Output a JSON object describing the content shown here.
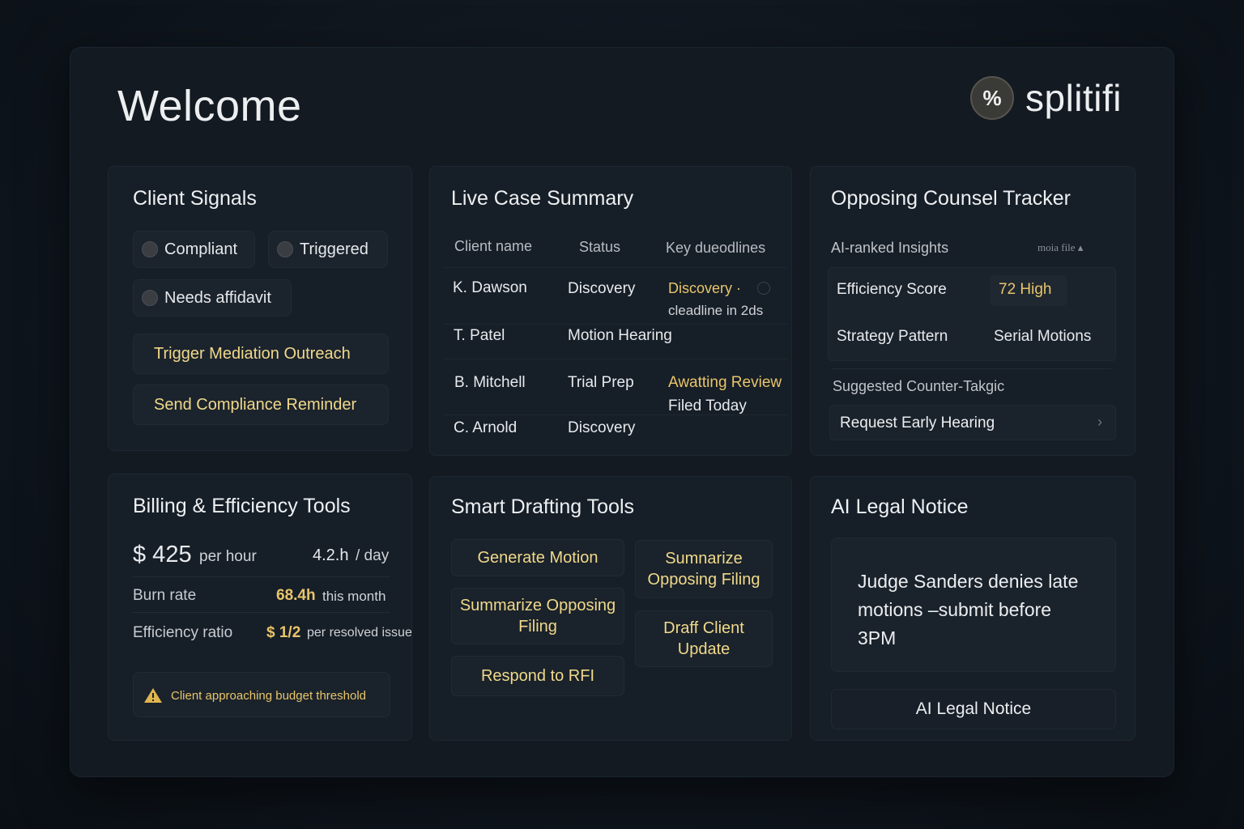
{
  "header": {
    "title": "Welcome",
    "brand_icon": "%",
    "brand_name": "splitifi"
  },
  "colors": {
    "accent_gold": "#e8c56a",
    "background": "#131a22",
    "card": "#161e27"
  },
  "client_signals": {
    "title": "Client Signals",
    "chips": [
      "Compliant",
      "Triggered",
      "Needs affidavit"
    ],
    "actions": [
      "Trigger Mediation Outreach",
      "Send Compliance Reminder"
    ]
  },
  "case_summary": {
    "title": "Live Case Summary",
    "columns": [
      "Client name",
      "Status",
      "Key dueodlines"
    ],
    "rows": [
      {
        "client": "K. Dawson",
        "status": "Discovery",
        "deadline": "Discovery ·",
        "deadline_sub": "cleadline in 2ds"
      },
      {
        "client": "T. Patel",
        "status": "Motion Hearing",
        "deadline": "",
        "deadline_sub": ""
      },
      {
        "client": "B. Mitchell",
        "status": "Trial Prep",
        "deadline": "Awatting Review",
        "deadline_sub": "Filed Today"
      },
      {
        "client": "C. Arnold",
        "status": "Discovery",
        "deadline": "",
        "deadline_sub": ""
      }
    ]
  },
  "opposing": {
    "title": "Opposing Counsel Tracker",
    "insights_label": "AI-ranked Insights",
    "insights_meta": "moia file ▴",
    "efficiency_label": "Efficiency Score",
    "efficiency_value": "72 High",
    "strategy_label": "Strategy Pattern",
    "strategy_value": "Serial Motions",
    "counter_label": "Suggested Counter-Takgic",
    "counter_action": "Request Early Hearing",
    "counter_chevron": "›"
  },
  "billing": {
    "title": "Billing & Efficiency Tools",
    "rate": "$ 425",
    "rate_unit": "per hour",
    "daily": "4.2.h",
    "daily_unit": "/ day",
    "burn_label": "Burn rate",
    "burn_value": "68.4h",
    "burn_unit": "this month",
    "ratio_label": "Efficiency ratio",
    "ratio_value": "$ 1/2",
    "ratio_unit": "per resolved issue",
    "alert": "Client approaching budget threshold"
  },
  "drafting": {
    "title": "Smart Drafting Tools",
    "buttons": [
      "Generate Motion",
      "Sumnarize Opposing Filing",
      "Summarize Opposing Filing",
      "Draff Client Update",
      "Respond to RFI"
    ]
  },
  "notice": {
    "title": "AI Legal Notice",
    "message": "Judge Sanders denies late motions –submit before 3PM",
    "button": "AI Legal Notice"
  }
}
